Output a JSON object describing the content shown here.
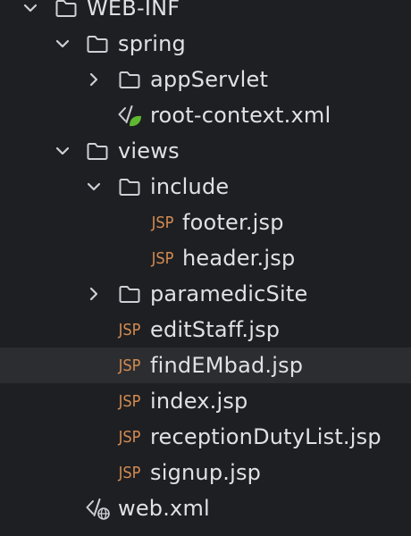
{
  "project_tree": {
    "nodes": [
      {
        "label": "WEB-INF",
        "type": "folder",
        "expanded": true,
        "name": "folder-web-inf"
      },
      {
        "label": "spring",
        "type": "folder",
        "expanded": true,
        "name": "folder-spring"
      },
      {
        "label": "appServlet",
        "type": "folder",
        "expanded": false,
        "name": "folder-appservlet"
      },
      {
        "label": "root-context.xml",
        "type": "spring-xml",
        "name": "file-root-context-xml"
      },
      {
        "label": "views",
        "type": "folder",
        "expanded": true,
        "name": "folder-views"
      },
      {
        "label": "include",
        "type": "folder",
        "expanded": true,
        "name": "folder-include"
      },
      {
        "label": "footer.jsp",
        "type": "jsp",
        "name": "file-footer-jsp"
      },
      {
        "label": "header.jsp",
        "type": "jsp",
        "name": "file-header-jsp"
      },
      {
        "label": "paramedicSite",
        "type": "folder",
        "expanded": false,
        "name": "folder-paramedicsite"
      },
      {
        "label": "editStaff.jsp",
        "type": "jsp",
        "name": "file-editstaff-jsp"
      },
      {
        "label": "findEMbad.jsp",
        "type": "jsp",
        "selected": true,
        "name": "file-findembad-jsp"
      },
      {
        "label": "index.jsp",
        "type": "jsp",
        "name": "file-index-jsp"
      },
      {
        "label": "receptionDutyList.jsp",
        "type": "jsp",
        "name": "file-receptiondutylist-jsp"
      },
      {
        "label": "signup.jsp",
        "type": "jsp",
        "name": "file-signup-jsp"
      },
      {
        "label": "web.xml",
        "type": "web-xml",
        "name": "file-web-xml"
      }
    ],
    "icons": {
      "jsp_text": "JSP",
      "chevron_expanded": "chevron-down-icon",
      "chevron_collapsed": "chevron-right-icon",
      "folder": "folder-icon",
      "jsp": "jsp-file-icon",
      "spring_xml": "spring-xml-file-icon",
      "web_xml": "web-xml-file-icon"
    },
    "colors": {
      "background": "#1e1f22",
      "selected_row": "#2b2d30",
      "text": "#dfe1e5",
      "icon": "#ced0d6",
      "jsp_badge": "#d48b52",
      "spring_leaf": "#5fb832"
    }
  }
}
